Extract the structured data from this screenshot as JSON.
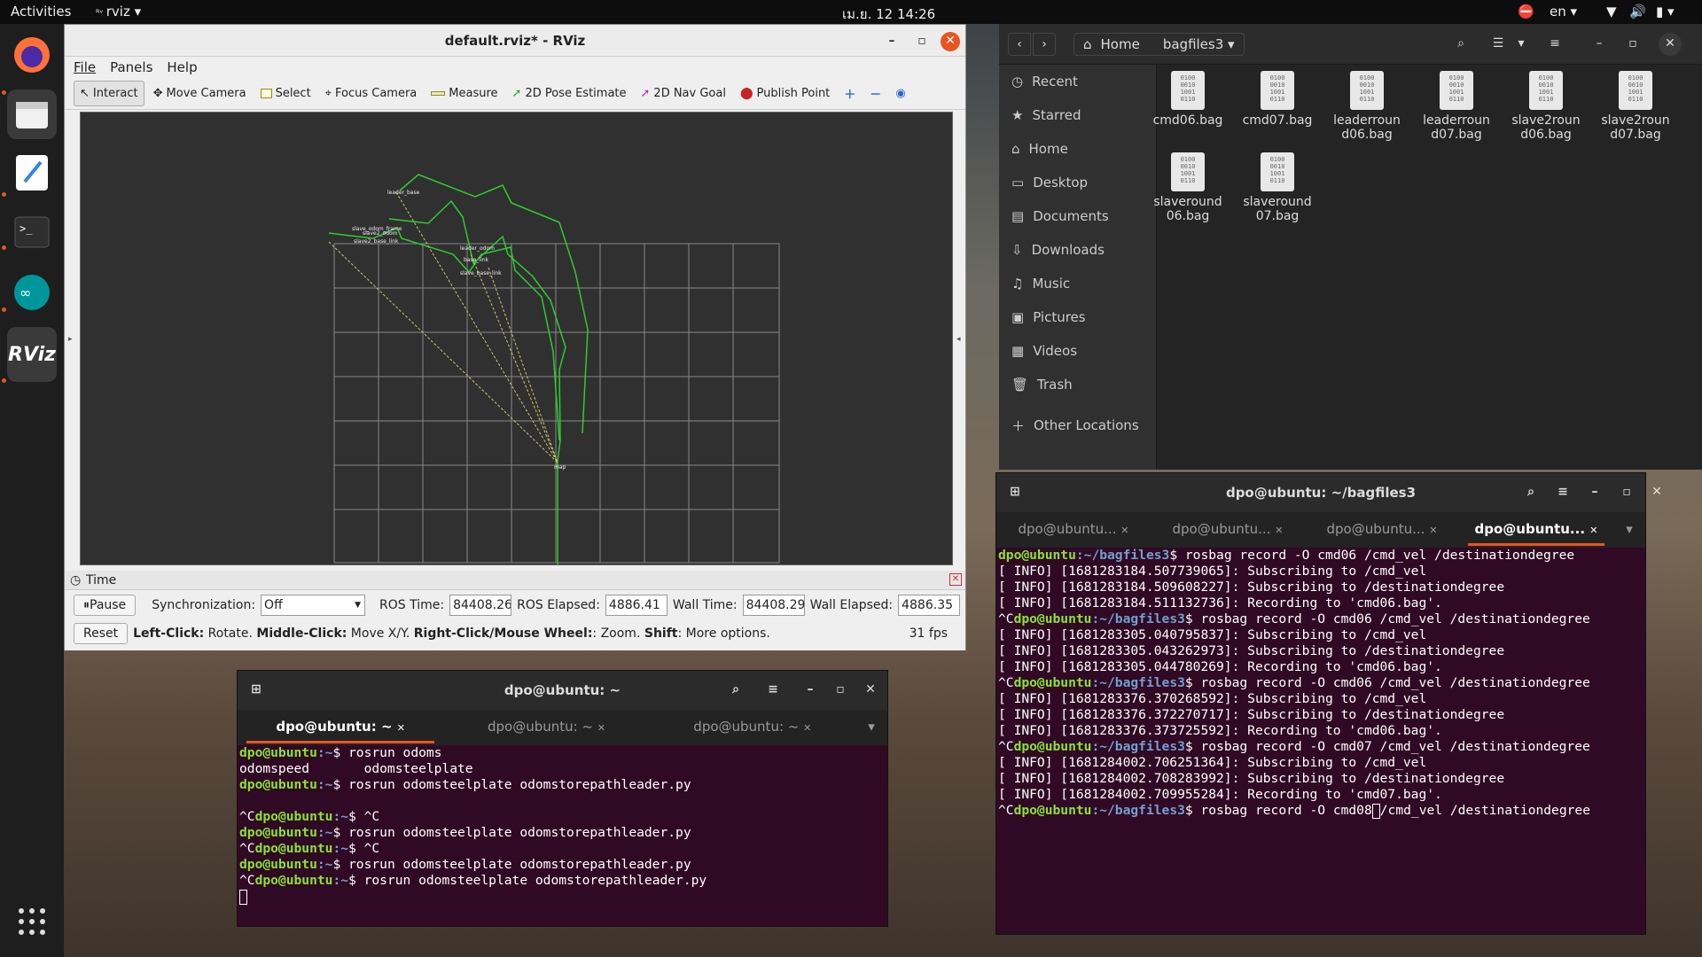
{
  "topbar": {
    "activities": "Activities",
    "app": "rviz",
    "datetime": "เม.ย. 12  14:26",
    "lang": "en"
  },
  "dock": [
    "firefox-icon",
    "files-icon",
    "text-editor-icon",
    "terminal-icon",
    "arduino-icon",
    "rviz-icon",
    "app-grid-icon"
  ],
  "rviz": {
    "title": "default.rviz* - RViz",
    "menu": [
      "File",
      "Panels",
      "Help"
    ],
    "tools": [
      "Interact",
      "Move Camera",
      "Select",
      "Focus Camera",
      "Measure",
      "2D Pose Estimate",
      "2D Nav Goal",
      "Publish Point"
    ],
    "time": {
      "header": "Time",
      "pause": "Pause",
      "sync_label": "Synchronization:",
      "sync_value": "Off",
      "ros_time_label": "ROS Time:",
      "ros_time": "84408.26",
      "ros_elapsed_label": "ROS Elapsed:",
      "ros_elapsed": "4886.41",
      "wall_time_label": "Wall Time:",
      "wall_time": "84408.29",
      "wall_elapsed_label": "Wall Elapsed:",
      "wall_elapsed": "4886.35",
      "reset": "Reset",
      "help_b1": "Left-Click:",
      "help_t1": " Rotate. ",
      "help_b2": "Middle-Click:",
      "help_t2": " Move X/Y. ",
      "help_b3": "Right-Click/Mouse Wheel:",
      "help_t3": ": Zoom. ",
      "help_b4": "Shift",
      "help_t4": ": More options.",
      "fps": "31 fps"
    }
  },
  "files": {
    "home": "Home",
    "folder": "bagfiles3",
    "sidebar": [
      "Recent",
      "Starred",
      "Home",
      "Desktop",
      "Documents",
      "Downloads",
      "Music",
      "Pictures",
      "Videos",
      "Trash",
      "Other Locations"
    ],
    "items": [
      {
        "l1": "cmd06.bag",
        "l2": ""
      },
      {
        "l1": "cmd07.bag",
        "l2": ""
      },
      {
        "l1": "leaderroun",
        "l2": "d06.bag"
      },
      {
        "l1": "leaderroun",
        "l2": "d07.bag"
      },
      {
        "l1": "slave2roun",
        "l2": "d06.bag"
      },
      {
        "l1": "slave2roun",
        "l2": "d07.bag"
      },
      {
        "l1": "slaveround",
        "l2": "06.bag"
      },
      {
        "l1": "slaveround",
        "l2": "07.bag"
      }
    ],
    "bin_text": "0100\n0010\n1001\n0110"
  },
  "term_right": {
    "title": "dpo@ubuntu: ~/bagfiles3",
    "tabs": [
      "dpo@ubuntu...",
      "dpo@ubuntu...",
      "dpo@ubuntu...",
      "dpo@ubuntu..."
    ],
    "user": "dpo@ubuntu",
    "path": ":~/bagfiles3",
    "lines": [
      {
        "pre": "",
        "prompt": true,
        "cmd": "$ rosbag record -O cmd06 /cmd_vel /destinationdegree"
      },
      {
        "pre": "[ INFO] [1681283184.507739065]: Subscribing to /cmd_vel",
        "prompt": false,
        "cmd": ""
      },
      {
        "pre": "[ INFO] [1681283184.509608227]: Subscribing to /destinationdegree",
        "prompt": false,
        "cmd": ""
      },
      {
        "pre": "[ INFO] [1681283184.511132736]: Recording to 'cmd06.bag'.",
        "prompt": false,
        "cmd": ""
      },
      {
        "pre": "^C",
        "prompt": true,
        "cmd": "$ rosbag record -O cmd06 /cmd_vel /destinationdegree"
      },
      {
        "pre": "[ INFO] [1681283305.040795837]: Subscribing to /cmd_vel",
        "prompt": false,
        "cmd": ""
      },
      {
        "pre": "[ INFO] [1681283305.043262973]: Subscribing to /destinationdegree",
        "prompt": false,
        "cmd": ""
      },
      {
        "pre": "[ INFO] [1681283305.044780269]: Recording to 'cmd06.bag'.",
        "prompt": false,
        "cmd": ""
      },
      {
        "pre": "^C",
        "prompt": true,
        "cmd": "$ rosbag record -O cmd06 /cmd_vel /destinationdegree"
      },
      {
        "pre": "[ INFO] [1681283376.370268592]: Subscribing to /cmd_vel",
        "prompt": false,
        "cmd": ""
      },
      {
        "pre": "[ INFO] [1681283376.372270717]: Subscribing to /destinationdegree",
        "prompt": false,
        "cmd": ""
      },
      {
        "pre": "[ INFO] [1681283376.373725592]: Recording to 'cmd06.bag'.",
        "prompt": false,
        "cmd": ""
      },
      {
        "pre": "^C",
        "prompt": true,
        "cmd": "$ rosbag record -O cmd07 /cmd_vel /destinationdegree"
      },
      {
        "pre": "[ INFO] [1681284002.706251364]: Subscribing to /cmd_vel",
        "prompt": false,
        "cmd": ""
      },
      {
        "pre": "[ INFO] [1681284002.708283992]: Subscribing to /destinationdegree",
        "prompt": false,
        "cmd": ""
      },
      {
        "pre": "[ INFO] [1681284002.709955284]: Recording to 'cmd07.bag'.",
        "prompt": false,
        "cmd": ""
      }
    ],
    "last_pre": "^C",
    "last_cmd_a": "$ rosbag record -O cmd08",
    "last_cmd_b": "/cmd_vel /destinationdegree"
  },
  "term_bottom": {
    "title": "dpo@ubuntu: ~",
    "tabs": [
      "dpo@ubuntu: ~",
      "dpo@ubuntu: ~",
      "dpo@ubuntu: ~"
    ],
    "user": "dpo@ubuntu",
    "path": ":~",
    "lines": [
      {
        "pre": "",
        "prompt": true,
        "cmd": "$ rosrun odoms"
      },
      {
        "pre": "odomspeed       odomsteelplate",
        "prompt": false,
        "cmd": ""
      },
      {
        "pre": "",
        "prompt": true,
        "cmd": "$ rosrun odomsteelplate odomstorepathleader.py"
      },
      {
        "pre": "",
        "prompt": false,
        "cmd": ""
      },
      {
        "pre": "^C",
        "prompt": true,
        "cmd": "$ ^C"
      },
      {
        "pre": "",
        "prompt": true,
        "cmd": "$ rosrun odomsteelplate odomstorepathleader.py"
      },
      {
        "pre": "^C",
        "prompt": true,
        "cmd": "$ ^C"
      },
      {
        "pre": "",
        "prompt": true,
        "cmd": "$ rosrun odomsteelplate odomstorepathleader.py"
      },
      {
        "pre": "^C",
        "prompt": true,
        "cmd": "$ rosrun odomsteelplate odomstorepathleader.py"
      }
    ]
  },
  "colors": {
    "accent": "#e95420",
    "term_bg": "#300a24",
    "prompt_user": "#8ae234",
    "prompt_path": "#729fcf",
    "path_green": "#2ecc2e"
  }
}
